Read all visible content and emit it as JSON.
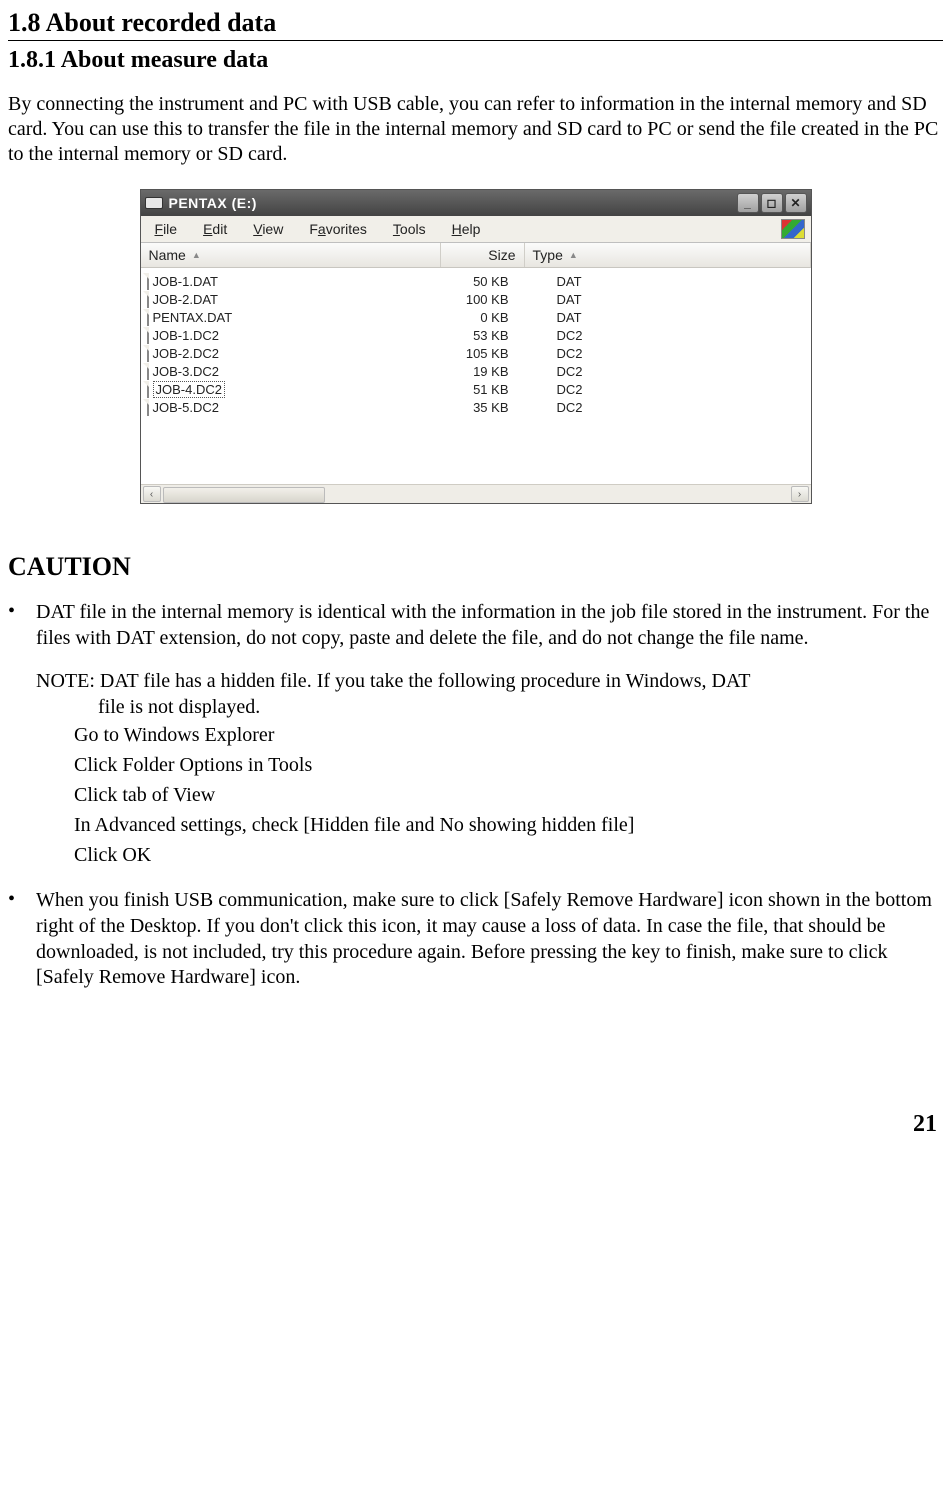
{
  "section": {
    "number": "1.8",
    "title": "About recorded data"
  },
  "subsection": {
    "number": "1.8.1",
    "title": "About measure data"
  },
  "intro": "By connecting the instrument and PC with USB cable, you can refer to information in the internal memory and SD card. You can use this to transfer the file in the internal memory and SD card to PC or send the file created in the PC to the internal memory or SD card.",
  "window": {
    "title": "PENTAX (E:)",
    "menus": [
      "File",
      "Edit",
      "View",
      "Favorites",
      "Tools",
      "Help"
    ],
    "columns": {
      "name": "Name",
      "size": "Size",
      "type": "Type"
    },
    "files": [
      {
        "name": "JOB-1.DAT",
        "size": "50 KB",
        "type": "DAT",
        "selected": false
      },
      {
        "name": "JOB-2.DAT",
        "size": "100 KB",
        "type": "DAT",
        "selected": false
      },
      {
        "name": "PENTAX.DAT",
        "size": "0 KB",
        "type": "DAT",
        "selected": false
      },
      {
        "name": "JOB-1.DC2",
        "size": "53 KB",
        "type": "DC2",
        "selected": false
      },
      {
        "name": "JOB-2.DC2",
        "size": "105 KB",
        "type": "DC2",
        "selected": false
      },
      {
        "name": "JOB-3.DC2",
        "size": "19 KB",
        "type": "DC2",
        "selected": false
      },
      {
        "name": "JOB-4.DC2",
        "size": "51 KB",
        "type": "DC2",
        "selected": true
      },
      {
        "name": "JOB-5.DC2",
        "size": "35 KB",
        "type": "DC2",
        "selected": false
      }
    ]
  },
  "caution_heading": "CAUTION",
  "bullets": [
    {
      "text": "DAT file in the internal memory is identical with the information in the job file stored in the instrument. For the files with DAT extension, do not copy, paste and delete the file, and do not change the file name.",
      "note_label": "NOTE:",
      "note_text1": "DAT file has a hidden file. If you take the following procedure in Windows, DAT",
      "note_text2": "file is not displayed.",
      "steps": [
        "Go to Windows Explorer",
        "Click Folder Options in Tools",
        "Click tab of View",
        "In Advanced settings, check [Hidden file and No showing hidden file]",
        "Click OK"
      ]
    },
    {
      "text": "When you finish USB communication, make sure to click [Safely Remove Hardware] icon shown in the bottom right of the Desktop. If you don't click this icon, it may cause a loss of data. In case the file, that should be downloaded, is not included, try this procedure again. Before pressing the key to finish, make sure to click [Safely Remove Hardware] icon."
    }
  ],
  "page_number": "21"
}
